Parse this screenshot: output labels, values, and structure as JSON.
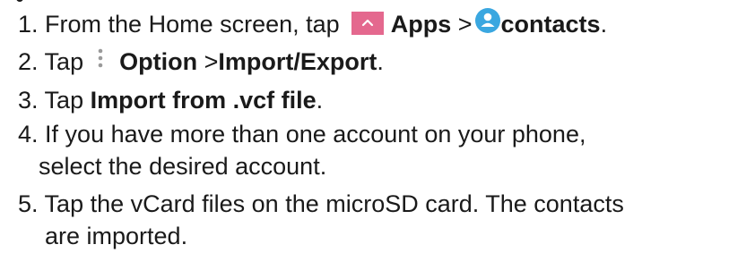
{
  "steps": [
    {
      "number": "1.",
      "text_before": "From the Home screen, tap",
      "bold_1": "Apps",
      "separator": ">",
      "bold_2": "contacts",
      "end": ".",
      "icons": [
        "apps-icon",
        "contacts-icon"
      ]
    },
    {
      "number": "2.",
      "text_before": "Tap",
      "bold_1": "Option",
      "separator": ">",
      "bold_2": "Import/Export",
      "end": ".",
      "icons": [
        "more-options-icon"
      ]
    },
    {
      "number": "3.",
      "text_before": "Tap",
      "bold_1": "Import from .vcf file",
      "end": "."
    },
    {
      "number": "4.",
      "line_1": "If you have more than one account on your phone,",
      "line_2": "select the desired account."
    },
    {
      "number": "5.",
      "line_1": "Tap the vCard files on the microSD card. The contacts",
      "line_2": "are imported."
    }
  ],
  "colors": {
    "text": "#1a1a1a",
    "apps_icon": "#e4688e",
    "contacts_icon": "#3aa7e0"
  }
}
